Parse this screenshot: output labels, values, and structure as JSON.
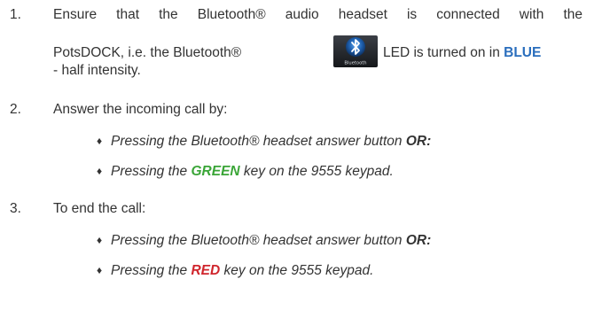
{
  "steps": [
    {
      "number": "1.",
      "line1": "Ensure that the Bluetooth® audio headset is connected with the",
      "line2_before": "PotsDOCK, i.e. the Bluetooth®",
      "line2_after": "LED is turned on in",
      "line2_color_word": "BLUE",
      "line3": "- half intensity.",
      "icon_label": "Bluetooth"
    },
    {
      "number": "2.",
      "text": "Answer the incoming call by:",
      "bullets": [
        {
          "before": "Pressing the Bluetooth® headset answer button",
          "emph": "OR:",
          "after": ""
        },
        {
          "before": "Pressing the",
          "emph": "GREEN",
          "after": "key on the 9555 keypad."
        }
      ]
    },
    {
      "number": "3.",
      "text": "To end the call:",
      "bullets": [
        {
          "before": "Pressing the Bluetooth® headset answer button",
          "emph": "OR:",
          "after": ""
        },
        {
          "before": "Pressing the",
          "emph": "RED",
          "after": "key on the 9555 keypad."
        }
      ]
    }
  ],
  "bullet_symbol": "♦",
  "colors": {
    "text": "#333333",
    "blue": "#2a6ebd",
    "green": "#3aa537",
    "red": "#d0262d"
  }
}
